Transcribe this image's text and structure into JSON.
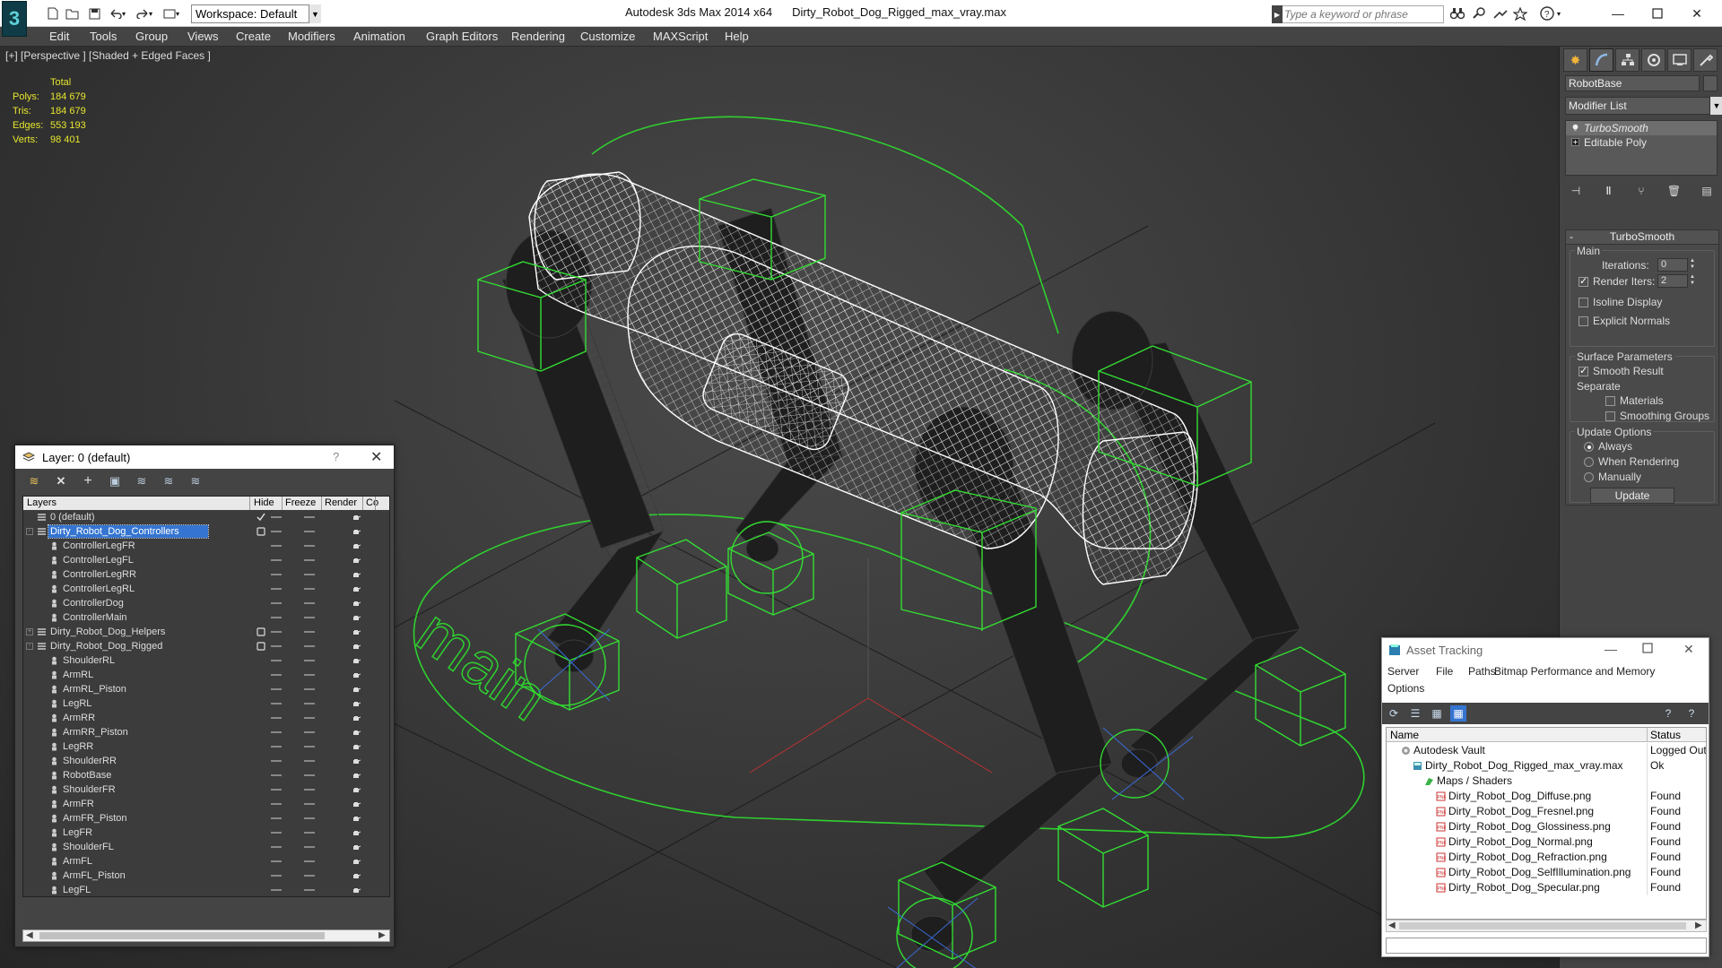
{
  "titlebar": {
    "workspace": "Workspace: Default",
    "app_name": "Autodesk 3ds Max  2014 x64",
    "document": "Dirty_Robot_Dog_Rigged_max_vray.max",
    "search_placeholder": "Type a keyword or phrase"
  },
  "menu": [
    "Edit",
    "Tools",
    "Group",
    "Views",
    "Create",
    "Modifiers",
    "Animation",
    "Graph Editors",
    "Rendering",
    "Customize",
    "MAXScript",
    "Help"
  ],
  "viewport": {
    "label": "[+] [Perspective ] [Shaded + Edged Faces ]",
    "stats_header": "Total",
    "stats": [
      {
        "label": "Polys:",
        "value": "184 679"
      },
      {
        "label": "Tris:",
        "value": "184 679"
      },
      {
        "label": "Edges:",
        "value": "553 193"
      },
      {
        "label": "Verts:",
        "value": "98 401"
      }
    ],
    "floor_text": "main"
  },
  "command_panel": {
    "object_name": "RobotBase",
    "modifier_list": "Modifier List",
    "stack": [
      "TurboSmooth",
      "Editable Poly"
    ],
    "rollout_title": "TurboSmooth",
    "main_group": "Main",
    "iterations_label": "Iterations:",
    "iterations_value": "0",
    "render_iters_label": "Render Iters:",
    "render_iters_value": "2",
    "isoline_label": "Isoline Display",
    "explicit_normals_label": "Explicit Normals",
    "surface_group": "Surface Parameters",
    "smooth_result_label": "Smooth Result",
    "separate_label": "Separate",
    "materials_label": "Materials",
    "smoothing_groups_label": "Smoothing Groups",
    "update_group": "Update Options",
    "update_always": "Always",
    "update_rendering": "When Rendering",
    "update_manually": "Manually",
    "update_button": "Update"
  },
  "layer_dialog": {
    "title": "Layer: 0 (default)",
    "help": "?",
    "columns": [
      "Layers",
      "Hide",
      "Freeze",
      "Render",
      "Co"
    ],
    "rows": [
      {
        "name": "0 (default)",
        "level": 0,
        "type": "layer",
        "current": true
      },
      {
        "name": "Dirty_Robot_Dog_Controllers",
        "level": 0,
        "type": "layer",
        "selected": true,
        "expand": "-"
      },
      {
        "name": "ControllerLegFR",
        "level": 1,
        "type": "object"
      },
      {
        "name": "ControllerLegFL",
        "level": 1,
        "type": "object"
      },
      {
        "name": "ControllerLegRR",
        "level": 1,
        "type": "object"
      },
      {
        "name": "ControllerLegRL",
        "level": 1,
        "type": "object"
      },
      {
        "name": "ControllerDog",
        "level": 1,
        "type": "object"
      },
      {
        "name": "ControllerMain",
        "level": 1,
        "type": "object"
      },
      {
        "name": "Dirty_Robot_Dog_Helpers",
        "level": 0,
        "type": "layer",
        "expand": "+"
      },
      {
        "name": "Dirty_Robot_Dog_Rigged",
        "level": 0,
        "type": "layer",
        "expand": "-"
      },
      {
        "name": "ShoulderRL",
        "level": 1,
        "type": "object"
      },
      {
        "name": "ArmRL",
        "level": 1,
        "type": "object"
      },
      {
        "name": "ArmRL_Piston",
        "level": 1,
        "type": "object"
      },
      {
        "name": "LegRL",
        "level": 1,
        "type": "object"
      },
      {
        "name": "ArmRR",
        "level": 1,
        "type": "object"
      },
      {
        "name": "ArmRR_Piston",
        "level": 1,
        "type": "object"
      },
      {
        "name": "LegRR",
        "level": 1,
        "type": "object"
      },
      {
        "name": "ShoulderRR",
        "level": 1,
        "type": "object"
      },
      {
        "name": "RobotBase",
        "level": 1,
        "type": "object"
      },
      {
        "name": "ShoulderFR",
        "level": 1,
        "type": "object"
      },
      {
        "name": "ArmFR",
        "level": 1,
        "type": "object"
      },
      {
        "name": "ArmFR_Piston",
        "level": 1,
        "type": "object"
      },
      {
        "name": "LegFR",
        "level": 1,
        "type": "object"
      },
      {
        "name": "ShoulderFL",
        "level": 1,
        "type": "object"
      },
      {
        "name": "ArmFL",
        "level": 1,
        "type": "object"
      },
      {
        "name": "ArmFL_Piston",
        "level": 1,
        "type": "object"
      },
      {
        "name": "LegFL",
        "level": 1,
        "type": "object"
      }
    ]
  },
  "asset_dialog": {
    "title": "Asset Tracking",
    "menu": [
      "Server",
      "File",
      "Paths",
      "Bitmap Performance and Memory",
      "Options"
    ],
    "columns": [
      "Name",
      "Status"
    ],
    "rows": [
      {
        "name": "Autodesk Vault",
        "status": "Logged Out",
        "level": 0,
        "icon": "vault"
      },
      {
        "name": "Dirty_Robot_Dog_Rigged_max_vray.max",
        "status": "Ok",
        "level": 1,
        "icon": "max"
      },
      {
        "name": "Maps / Shaders",
        "status": "",
        "level": 2,
        "icon": "maps"
      },
      {
        "name": "Dirty_Robot_Dog_Diffuse.png",
        "status": "Found",
        "level": 3,
        "icon": "png"
      },
      {
        "name": "Dirty_Robot_Dog_Fresnel.png",
        "status": "Found",
        "level": 3,
        "icon": "png"
      },
      {
        "name": "Dirty_Robot_Dog_Glossiness.png",
        "status": "Found",
        "level": 3,
        "icon": "png"
      },
      {
        "name": "Dirty_Robot_Dog_Normal.png",
        "status": "Found",
        "level": 3,
        "icon": "png"
      },
      {
        "name": "Dirty_Robot_Dog_Refraction.png",
        "status": "Found",
        "level": 3,
        "icon": "png"
      },
      {
        "name": "Dirty_Robot_Dog_SelfIllumination.png",
        "status": "Found",
        "level": 3,
        "icon": "png"
      },
      {
        "name": "Dirty_Robot_Dog_Specular.png",
        "status": "Found",
        "level": 3,
        "icon": "png"
      }
    ]
  },
  "colors": {
    "wire_green": "#33dd33",
    "stats_yellow": "#e6e62e",
    "selection_blue": "#3575d1",
    "panel_gray": "#444444"
  }
}
